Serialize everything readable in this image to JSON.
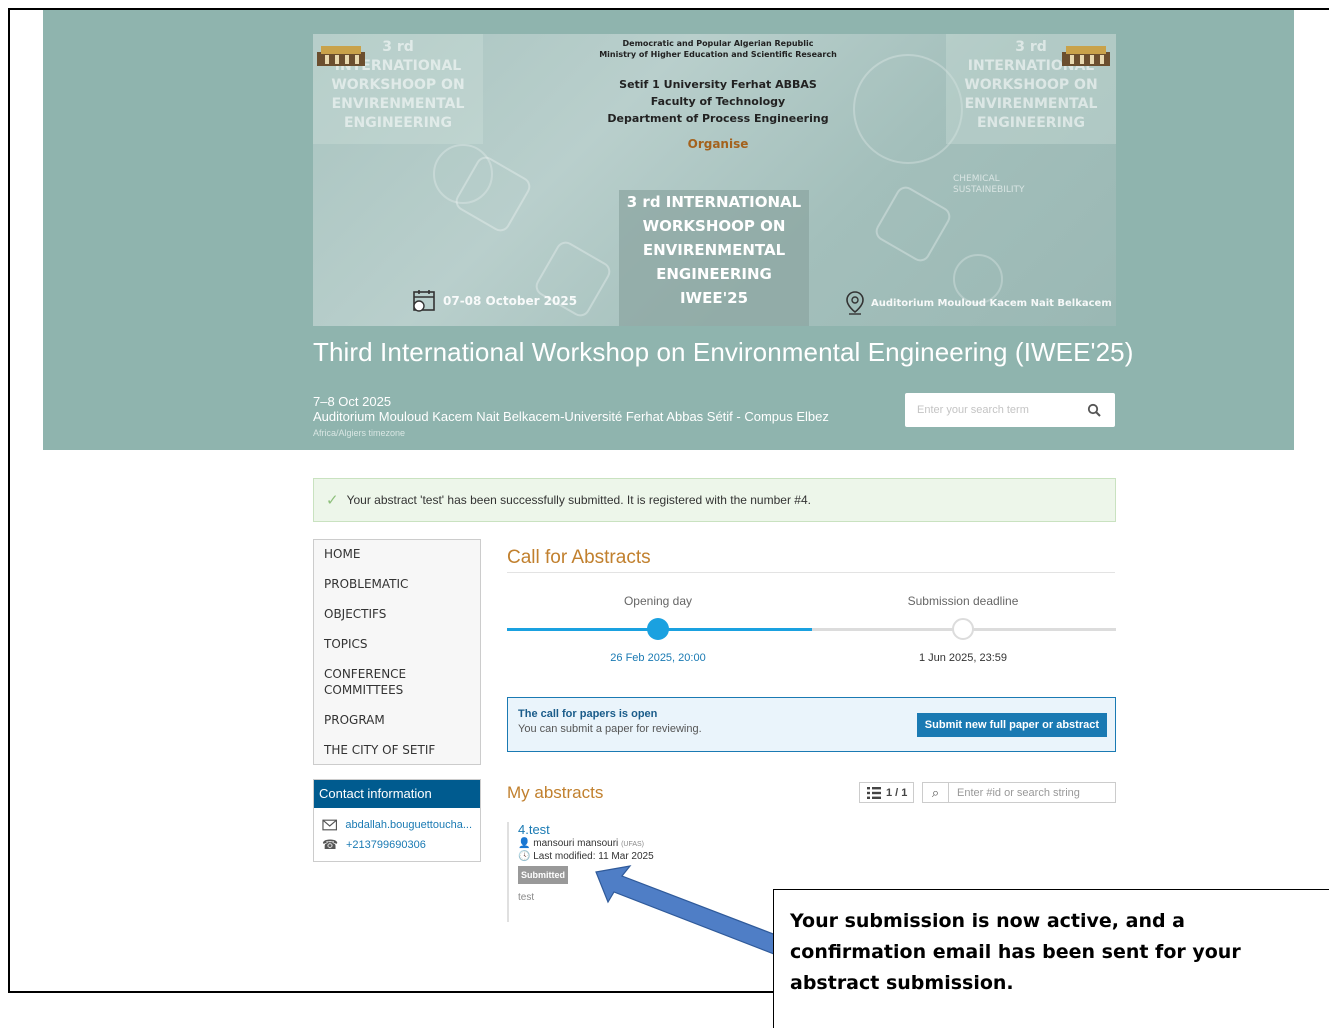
{
  "banner": {
    "republic_line1": "Democratic and Popular Algerian Republic",
    "republic_line2": "Ministry of Higher Education and Scientific Research",
    "university_line1": "Setif 1 University Ferhat ABBAS",
    "university_line2": "Faculty of Technology",
    "university_line3": "Department of Process Engineering",
    "organise": "Organise",
    "workshop_line1": "3 rd INTERNATIONAL",
    "workshop_line2": "WORKSHOOP ON",
    "workshop_line3": "ENVIRENMENTAL",
    "workshop_line4": "ENGINEERING",
    "workshop_line5": "IWEE'25",
    "side_text": "3 rd INTERNATIONAL WORKSHOOP ON ENVIRENMENTAL ENGINEERING",
    "date": "07-08 October 2025",
    "place": "Auditorium Mouloud Kacem Nait Belkacem",
    "chemical": "CHEMICAL SUSTAINEBILITY"
  },
  "conference": {
    "title": "Third International Workshop on Environmental Engineering (IWEE'25)",
    "dates": "7–8 Oct 2025",
    "venue": "Auditorium Mouloud Kacem Nait Belkacem-Université Ferhat Abbas Sétif - Compus Elbez",
    "timezone": "Africa/Algiers timezone",
    "search_placeholder": "Enter your search term"
  },
  "notice": {
    "text": "Your abstract 'test' has been successfully submitted. It is registered with the number #4."
  },
  "menu": {
    "items": [
      "HOME",
      "PROBLEMATIC",
      "OBJECTIFS",
      "TOPICS",
      "CONFERENCE COMMITTEES",
      "PROGRAM",
      "THE CITY OF SETIF"
    ]
  },
  "contact": {
    "title": "Contact information",
    "email": "abdallah.bouguettoucha...",
    "phone": "+213799690306"
  },
  "cfa": {
    "title": "Call for Abstracts",
    "opening_label": "Opening day",
    "opening_date": "26 Feb 2025, 20:00",
    "deadline_label": "Submission deadline",
    "deadline_date": "1 Jun 2025, 23:59",
    "open_title": "The call for papers is open",
    "open_sub": "You can submit a paper for reviewing.",
    "submit_label": "Submit new full paper or abstract"
  },
  "my_abstracts": {
    "title": "My abstracts",
    "pager": "1 / 1",
    "search_placeholder": "Enter #id or search string",
    "entry": {
      "title": "4.test",
      "author": "mansouri mansouri",
      "affiliation": "(UFAS)",
      "modified": "Last modified: 11 Mar 2025",
      "status": "Submitted",
      "description": "test"
    }
  },
  "callout": {
    "line1": "Your submission is now active, and a",
    "line2": "confirmation email has been sent for your",
    "line3": "abstract submission."
  },
  "colors": {
    "header": "#8fb4ae",
    "accent": "#1a7ab3",
    "section_title": "#c1802e",
    "contact_head": "#005b8f"
  }
}
